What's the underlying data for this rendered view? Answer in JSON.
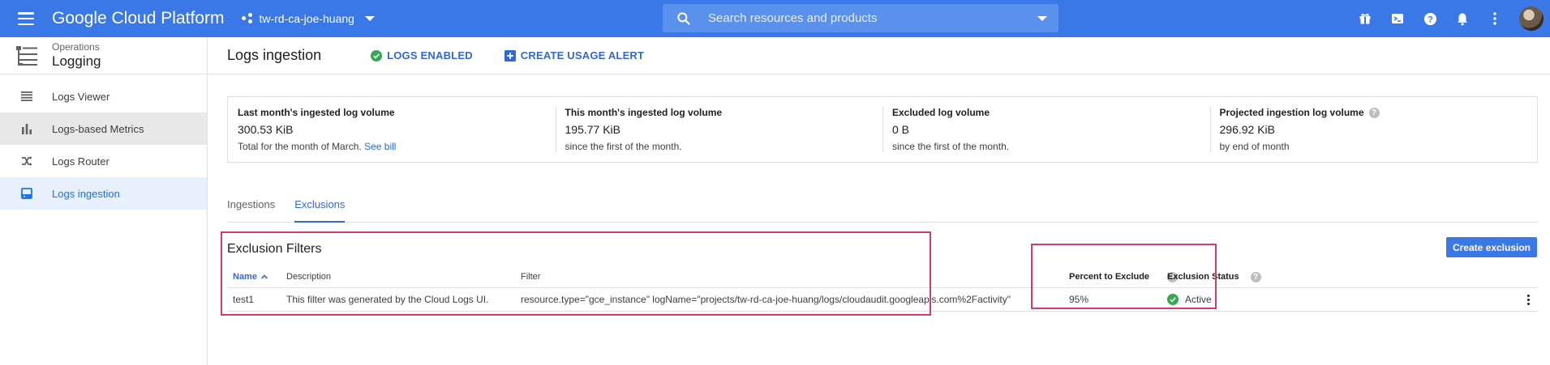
{
  "topbar": {
    "brand": "Google Cloud Platform",
    "project": "tw-rd-ca-joe-huang",
    "search_placeholder": "Search resources and products",
    "icons": [
      "gift-icon",
      "cloud-shell-icon",
      "help-icon",
      "notifications-icon",
      "more-vert-icon",
      "avatar"
    ]
  },
  "sidebar": {
    "section_sub": "Operations",
    "section_title": "Logging",
    "items": [
      {
        "label": "Logs Viewer",
        "icon": "list-icon",
        "state": "normal"
      },
      {
        "label": "Logs-based Metrics",
        "icon": "bar-chart-icon",
        "state": "hover"
      },
      {
        "label": "Logs Router",
        "icon": "router-icon",
        "state": "normal"
      },
      {
        "label": "Logs ingestion",
        "icon": "storage-icon",
        "state": "active"
      }
    ]
  },
  "page": {
    "title": "Logs ingestion",
    "logs_enabled": "LOGS ENABLED",
    "create_alert": "CREATE USAGE ALERT"
  },
  "stats": [
    {
      "label": "Last month's ingested log volume",
      "value": "300.53 KiB",
      "sub": "Total for the month of March.",
      "link": "See bill"
    },
    {
      "label": "This month's ingested log volume",
      "value": "195.77 KiB",
      "sub": "since the first of the month."
    },
    {
      "label": "Excluded log volume",
      "value": "0 B",
      "sub": "since the first of the month."
    },
    {
      "label": "Projected ingestion log volume",
      "value": "296.92 KiB",
      "sub": "by end of month"
    }
  ],
  "tabs": [
    {
      "label": "Ingestions",
      "active": false
    },
    {
      "label": "Exclusions",
      "active": true
    }
  ],
  "exclusions": {
    "title": "Exclusion Filters",
    "create_label": "Create exclusion",
    "headers": {
      "name": "Name",
      "description": "Description",
      "filter": "Filter",
      "percent": "Percent to Exclude",
      "status": "Exclusion Status"
    },
    "rows": [
      {
        "name": "test1",
        "description": "This filter was generated by the Cloud Logs UI.",
        "filter": "resource.type=\"gce_instance\" logName=\"projects/tw-rd-ca-joe-huang/logs/cloudaudit.googleapis.com%2Factivity\"",
        "percent": "95%",
        "status": "Active"
      }
    ]
  },
  "colors": {
    "topbar": "#3b78e7",
    "accent": "#3367d6",
    "highlight": "#d63a6e",
    "success": "#34a853"
  }
}
